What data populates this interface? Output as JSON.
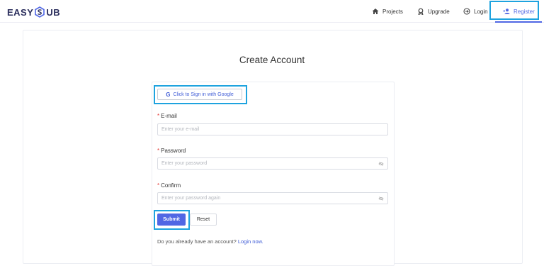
{
  "brand": {
    "name_left": "EASY",
    "name_right": "UB"
  },
  "nav": [
    {
      "label": "Projects",
      "icon": "home-icon"
    },
    {
      "label": "Upgrade",
      "icon": "badge-icon"
    },
    {
      "label": "Login",
      "icon": "login-icon"
    },
    {
      "label": "Register",
      "icon": "add-user-icon"
    }
  ],
  "page": {
    "title": "Create Account"
  },
  "form": {
    "google_label": "Click to Sign in with Google",
    "email_label": "E-mail",
    "email_placeholder": "Enter your e-mail",
    "password_label": "Password",
    "password_placeholder": "Enter your password",
    "confirm_label": "Confirm",
    "confirm_placeholder": "Enter your password again",
    "submit_label": "Submit",
    "reset_label": "Reset",
    "have_account_text": "Do you already have an account?",
    "login_link": "Login now."
  },
  "colors": {
    "accent": "#5067e4",
    "highlight": "#1ea3df",
    "required": "#e53935"
  }
}
